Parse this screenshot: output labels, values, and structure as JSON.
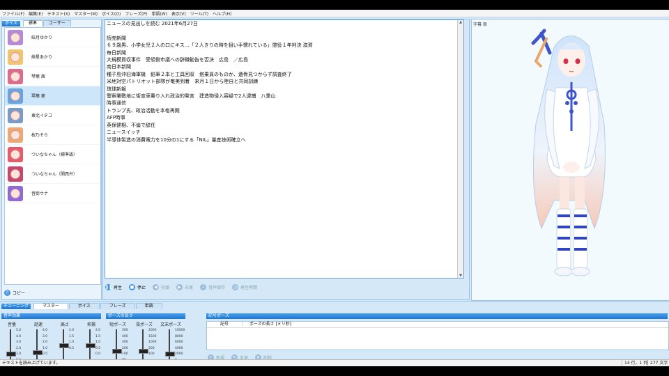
{
  "menu": [
    "ファイル(F)",
    "編集(E)",
    "テキスト(X)",
    "マスター(M)",
    "ボイス(O)",
    "フレーズ(P)",
    "単語(W)",
    "表示(V)",
    "ツール(T)",
    "ヘルプ(H)"
  ],
  "voice_panel": {
    "header": "ボイス",
    "tabs": [
      "標準",
      "ユーザー"
    ],
    "items": [
      {
        "name": "結月ゆかり",
        "color": "#b58ad8"
      },
      {
        "name": "紲星あかり",
        "color": "#f4c36a"
      },
      {
        "name": "琴葉 茜",
        "color": "#e06a8a"
      },
      {
        "name": "琴葉 葵",
        "color": "#6aa4e0"
      },
      {
        "name": "東北イタコ",
        "color": "#7a9ac8"
      },
      {
        "name": "桜乃そら",
        "color": "#f0a870"
      },
      {
        "name": "ついなちゃん（標準語）",
        "color": "#e85a6a"
      },
      {
        "name": "ついなちゃん（関西弁）",
        "color": "#c8476a"
      },
      {
        "name": "音街ウナ",
        "color": "#8e6ad8"
      }
    ],
    "selected_index": 3,
    "copy_label": "コピー"
  },
  "editor": {
    "lines": [
      "ニュースの見出しを読む 2021年6月27日",
      "",
      "読売新聞",
      "６９歳男、小学女児２人の口にキス…「２人きりの時を狙い手慣れている」懲役１年判決 滋賀",
      "毎日新聞",
      "大規模買収事件　受領側市議への辞職勧告を否決　広島　／広島",
      "南日本新聞",
      "種子島沖旧海軍機　鉛筆２本と工具回収　搭乗員のものか、遺骨見つからず調査終了",
      "米地対空パトリオット部隊が奄美到着　来月１日から陸自と共同訓練",
      "琉球新報",
      "警察署敷地に街宣車乗り入れ政治的発言　建造物侵入容疑で2人逮捕　八重山",
      "時事通信",
      "トランプ氏、政治活動を本格再開",
      "AFP時事",
      "英保健相、不倫で辞任",
      "ニュースイッチ",
      "半導体製造の消費電力を10分の1にする「NIL」量産技術確立へ"
    ],
    "play_buttons": [
      {
        "label": "再生",
        "icon": "pause-icon",
        "enabled": true
      },
      {
        "label": "停止",
        "icon": "stop-icon",
        "enabled": true
      },
      {
        "label": "先頭",
        "icon": "skip-back-icon",
        "enabled": false
      },
      {
        "label": "末尾",
        "icon": "skip-forward-icon",
        "enabled": false
      },
      {
        "label": "音声保存",
        "icon": "save-icon",
        "enabled": false
      },
      {
        "label": "再生時間",
        "icon": "clock-icon",
        "enabled": false
      }
    ]
  },
  "character_panel": {
    "toolbar": "字幕 目"
  },
  "tuning": {
    "header": "チューニング",
    "tabs": [
      "マスター",
      "ボイス",
      "フレーズ",
      "単語"
    ],
    "voice_effect_header": "音声効果",
    "pause_length_header": "ポーズの長さ",
    "sliders": [
      {
        "label": "音量",
        "ticks": [
          "5.0",
          "4.0",
          "3.0",
          "2.0",
          "1.0",
          "0.0"
        ],
        "value_fraction": 0.2
      },
      {
        "label": "話速",
        "ticks": [
          "4.0",
          "3.0",
          "2.0",
          "1.0",
          "0.5"
        ],
        "value_fraction": 0.25
      },
      {
        "label": "高さ",
        "ticks": [
          "2.0",
          "1.5",
          "1.0",
          "0.5"
        ],
        "value_fraction": 0.5
      },
      {
        "label": "抑揚",
        "ticks": [
          "2.0",
          "1.5",
          "1.0",
          "0.5",
          "0.0"
        ],
        "value_fraction": 0.5
      },
      {
        "label": "短ポーズ",
        "ticks": [
          "500",
          "400",
          "300",
          "200",
          "100",
          "80"
        ],
        "value_fraction": 0.3
      },
      {
        "label": "長ポーズ",
        "ticks": [
          "2000",
          "1500",
          "1000",
          "500",
          "100"
        ],
        "value_fraction": 0.3
      },
      {
        "label": "文末ポーズ",
        "ticks": [
          "10000",
          "8000",
          "6000",
          "4000",
          "2000",
          "0"
        ],
        "value_fraction": 0.2
      }
    ],
    "pose_header": "記号ポーズ",
    "pose_columns": [
      "記号",
      "ポーズの長さ [ミリ秒]"
    ],
    "pose_buttons": [
      "新規",
      "変更",
      "削除"
    ]
  },
  "status": {
    "message": "テキストを読み上げています。",
    "position": "14 行，1 列",
    "chars": "277 文字"
  }
}
